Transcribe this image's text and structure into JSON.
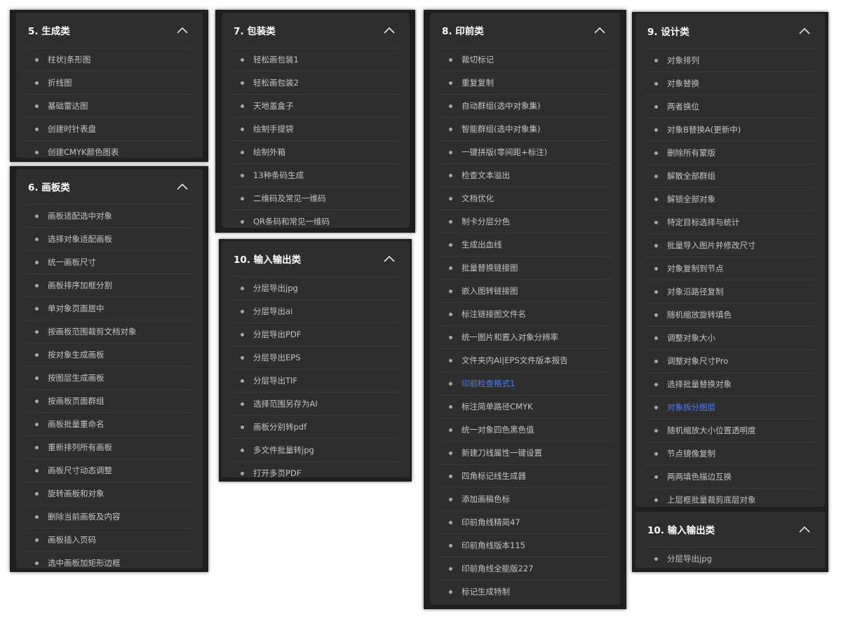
{
  "panels": [
    {
      "title": "5. 生成类",
      "icon": "chevron-up-icon",
      "items": [
        "柱状|条形图",
        "折线图",
        "基础雷达图",
        "创建时针表盘",
        "创建CMYK颜色图表"
      ]
    },
    {
      "title": "6. 画板类",
      "icon": "chevron-up-icon",
      "items": [
        "画板适配选中对象",
        "选择对象适配画板",
        "统一画板尺寸",
        "画板排序加框分割",
        "单对象页面居中",
        "按画板范围裁剪文档对象",
        "按对象生成画板",
        "按图层生成画板",
        "按画板页面群组",
        "画板批量重命名",
        "重新排列所有画板",
        "画板尺寸动态调整",
        "旋转画板和对象",
        "删除当前画板及内容",
        "画板插入页码",
        "选中画板加矩形边框"
      ]
    },
    {
      "title": "7. 包装类",
      "icon": "chevron-up-icon",
      "items": [
        "轻松画包装1",
        "轻松画包装2",
        "天地盖盒子",
        "绘制手提袋",
        "绘制外箱",
        "13种条码生成",
        "二维码及常见一维码",
        "QR条码和常见一维码"
      ]
    },
    {
      "title": "10. 输入输出类",
      "icon": "chevron-up-icon",
      "items": [
        "分层导出jpg",
        "分层导出ai",
        "分层导出PDF",
        "分层导出EPS",
        "分层导出TIF",
        "选择范围另存为AI",
        "画板分别转pdf",
        "多文件批量转jpg",
        "打开多页PDF"
      ]
    },
    {
      "title": "8. 印前类",
      "icon": "chevron-up-icon",
      "active_index": 14,
      "items": [
        "裁切标记",
        "重复复制",
        "自动群组(选中对象集)",
        "智能群组(选中对象集)",
        "一键拼版(零间距+标注)",
        "检查文本溢出",
        "文档优化",
        "制卡分层分色",
        "生成出血线",
        "批量替换链接图",
        "嵌入图转链接图",
        "标注链接图文件名",
        "统一图片和置入对象分辨率",
        "文件夹内AI|EPS文件版本报告",
        "印前检查格式1",
        "标注简单路径CMYK",
        "统一对象四色黑色值",
        "新建刀线属性一键设置",
        "四角标记线生成器",
        "添加画稿色标",
        "印前角线精简47",
        "印前角线版本115",
        "印前角线全能版227",
        "标记生成特制"
      ]
    },
    {
      "title": "9. 设计类",
      "icon": "chevron-up-icon",
      "active_index": 15,
      "items": [
        "对象排列",
        "对象替换",
        "两者换位",
        "对象B替换A(更新中)",
        "删除所有蒙版",
        "解散全部群组",
        "解锁全部对象",
        "特定目标选择与统计",
        "批量导入图片并修改尺寸",
        "对象复制到节点",
        "对象沿路径复制",
        "随机缩放旋转填色",
        "调整对象大小",
        "调整对象尺寸Pro",
        "选择批量替换对象",
        "对象拆分图层",
        "随机缩放大小位置透明度",
        "节点镜像复制",
        "两两填色描边互换",
        "上层框批量裁剪底层对象"
      ]
    },
    {
      "title": "10. 输入输出类",
      "icon": "chevron-up-icon",
      "items": [
        "分层导出jpg"
      ]
    }
  ],
  "colors": {
    "frame": "#1f1f1f",
    "panel": "#2e2e2e",
    "title": "#ffffff",
    "item_text": "#c4c4c4",
    "active_text": "#4d7ef3",
    "divider": "#3b3b3b"
  }
}
